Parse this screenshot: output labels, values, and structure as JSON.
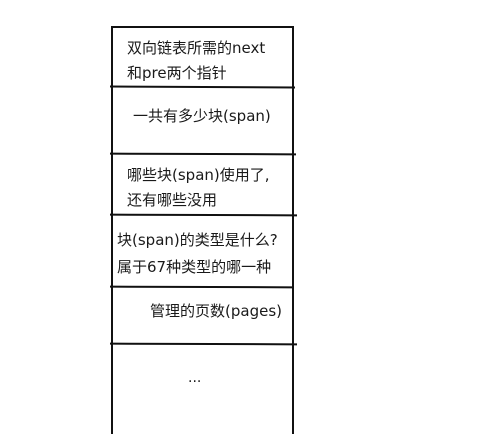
{
  "blocks": [
    {
      "lines": [
        "双向链表所需的next",
        "和pre两个指针"
      ]
    },
    {
      "lines": [
        "一共有多少块(span)"
      ]
    },
    {
      "lines": [
        "哪些块(span)使用了,",
        "还有哪些没用"
      ]
    },
    {
      "lines": [
        "块(span)的类型是什么?",
        "属于67种类型的哪一种"
      ]
    },
    {
      "lines": [
        "管理的页数(pages)"
      ]
    },
    {
      "lines": [
        "..."
      ]
    }
  ]
}
